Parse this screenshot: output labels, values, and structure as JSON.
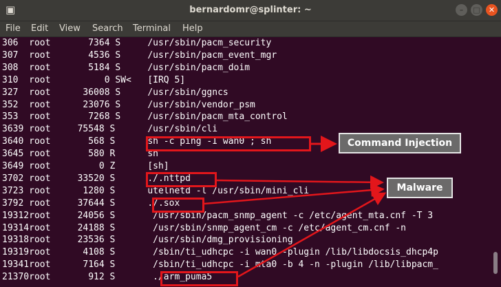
{
  "window": {
    "title": "bernardomr@splinter: ~",
    "menu_icon": "terminal-icon"
  },
  "window_controls": {
    "minimize": "–",
    "maximize": "□",
    "close": "✕"
  },
  "menubar": {
    "items": [
      "File",
      "Edit",
      "View",
      "Search",
      "Terminal",
      "Help"
    ]
  },
  "processes": [
    {
      "pid": "306",
      "user": "root",
      "vsz": "7364",
      "stat": "S",
      "command": "/usr/sbin/pacm_security"
    },
    {
      "pid": "307",
      "user": "root",
      "vsz": "4536",
      "stat": "S",
      "command": "/usr/sbin/pacm_event_mgr"
    },
    {
      "pid": "308",
      "user": "root",
      "vsz": "5184",
      "stat": "S",
      "command": "/usr/sbin/pacm_doim"
    },
    {
      "pid": "310",
      "user": "root",
      "vsz": "0",
      "stat": "SW<",
      "command": "[IRQ 5]"
    },
    {
      "pid": "327",
      "user": "root",
      "vsz": "36008",
      "stat": "S",
      "command": "/usr/sbin/ggncs"
    },
    {
      "pid": "352",
      "user": "root",
      "vsz": "23076",
      "stat": "S",
      "command": "/usr/sbin/vendor_psm"
    },
    {
      "pid": "353",
      "user": "root",
      "vsz": "7268",
      "stat": "S",
      "command": "/usr/sbin/pacm_mta_control"
    },
    {
      "pid": "3639",
      "user": "root",
      "vsz": "75548",
      "stat": "S",
      "command": "/usr/sbin/cli"
    },
    {
      "pid": "3640",
      "user": "root",
      "vsz": "568",
      "stat": "S",
      "command": "sh -c ping -I wan0 ; sh"
    },
    {
      "pid": "3645",
      "user": "root",
      "vsz": "580",
      "stat": "R",
      "command": "sh"
    },
    {
      "pid": "3649",
      "user": "root",
      "vsz": "0",
      "stat": "Z",
      "command": "[sh]"
    },
    {
      "pid": "3702",
      "user": "root",
      "vsz": "33520",
      "stat": "S",
      "command": "./.nttpd"
    },
    {
      "pid": "3723",
      "user": "root",
      "vsz": "1280",
      "stat": "S",
      "command": "utelnetd -l /usr/sbin/mini_cli"
    },
    {
      "pid": "3792",
      "user": "root",
      "vsz": "37644",
      "stat": "S",
      "command": "./.sox"
    },
    {
      "pid": "19312",
      "user": "root",
      "vsz": "24056",
      "stat": "S",
      "command": "/usr/sbin/pacm_snmp_agent -c /etc/agent_mta.cnf -T 3"
    },
    {
      "pid": "19314",
      "user": "root",
      "vsz": "24188",
      "stat": "S",
      "command": "/usr/sbin/snmp_agent_cm -c /etc/agent_cm.cnf -n"
    },
    {
      "pid": "19318",
      "user": "root",
      "vsz": "23536",
      "stat": "S",
      "command": "/usr/sbin/dmg_provisioning"
    },
    {
      "pid": "19319",
      "user": "root",
      "vsz": "4108",
      "stat": "S",
      "command": "/sbin/ti_udhcpc -i wan0 -plugin /lib/libdocsis_dhcp4p"
    },
    {
      "pid": "19341",
      "user": "root",
      "vsz": "7164",
      "stat": "S",
      "command": "/sbin/ti_udhcpc -i mta0 -b 4 -n -plugin /lib/libpacm_"
    },
    {
      "pid": "21370",
      "user": "root",
      "vsz": "912",
      "stat": "S",
      "command": "./arm_puma5"
    }
  ],
  "annotations": {
    "command_injection": "Command Injection",
    "malware": "Malware",
    "highlight_color": "#e3161b"
  },
  "colors": {
    "terminal_bg": "#300a24",
    "terminal_fg": "#ffffff",
    "titlebar_bg": "#3c3b37",
    "close_btn": "#e95420"
  }
}
